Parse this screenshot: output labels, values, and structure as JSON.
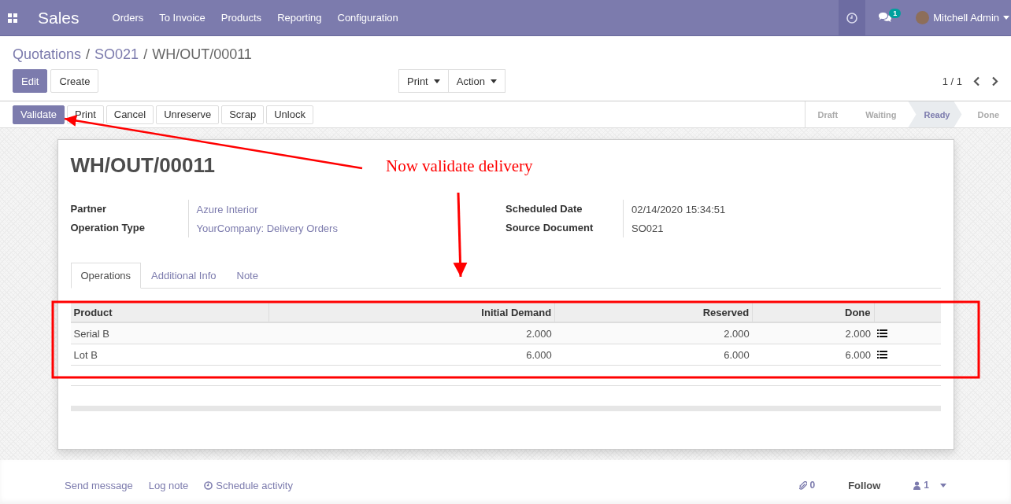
{
  "navbar": {
    "app": "Sales",
    "menu": [
      "Orders",
      "To Invoice",
      "Products",
      "Reporting",
      "Configuration"
    ],
    "messages_badge": "1",
    "user": "Mitchell Admin"
  },
  "breadcrumb": [
    {
      "kind": "item",
      "label": "Quotations",
      "link": true
    },
    {
      "kind": "separator",
      "label": "/"
    },
    {
      "kind": "item",
      "label": "SO021",
      "link": true
    },
    {
      "kind": "separator",
      "label": "/"
    },
    {
      "kind": "item",
      "label": "WH/OUT/00011",
      "link": false
    }
  ],
  "control_buttons": [
    {
      "label": "Edit",
      "primary": true
    },
    {
      "label": "Create",
      "primary": false
    }
  ],
  "dropdowns": [
    "Print",
    "Action"
  ],
  "pager": "1 / 1",
  "header_buttons": [
    {
      "label": "Validate",
      "primary": true
    },
    {
      "label": "Print",
      "primary": false
    },
    {
      "label": "Cancel",
      "primary": false
    },
    {
      "label": "Unreserve",
      "primary": false
    },
    {
      "label": "Scrap",
      "primary": false
    },
    {
      "label": "Unlock",
      "primary": false
    }
  ],
  "status_steps": [
    {
      "label": "Draft",
      "selected": false
    },
    {
      "label": "Waiting",
      "selected": false
    },
    {
      "label": "Ready",
      "selected": true
    },
    {
      "label": "Done",
      "selected": false
    }
  ],
  "record": {
    "title": "WH/OUT/00011",
    "left_fields": [
      {
        "label": "Partner",
        "value": "Azure Interior",
        "link": true
      },
      {
        "label": "Operation Type",
        "value": "YourCompany: Delivery Orders",
        "link": true
      }
    ],
    "right_fields": [
      {
        "label": "Scheduled Date",
        "value": "02/14/2020 15:34:51",
        "link": false
      },
      {
        "label": "Source Document",
        "value": "SO021",
        "link": false
      }
    ]
  },
  "tabs": [
    {
      "label": "Operations",
      "selected": true
    },
    {
      "label": "Additional Info",
      "selected": false
    },
    {
      "label": "Note",
      "selected": false
    }
  ],
  "table": {
    "columns": [
      "Product",
      "Initial Demand",
      "Reserved",
      "Done"
    ],
    "rows": [
      {
        "cells": [
          "Serial B",
          "2.000",
          "2.000",
          "2.000"
        ]
      },
      {
        "cells": [
          "Lot B",
          "6.000",
          "6.000",
          "6.000"
        ]
      }
    ]
  },
  "chatter": {
    "send_message": "Send message",
    "log_note": "Log note",
    "schedule_activity": "Schedule activity",
    "attachments": "0",
    "follow": "Follow",
    "followers": "1"
  },
  "annotation": {
    "text": "Now validate delivery"
  }
}
